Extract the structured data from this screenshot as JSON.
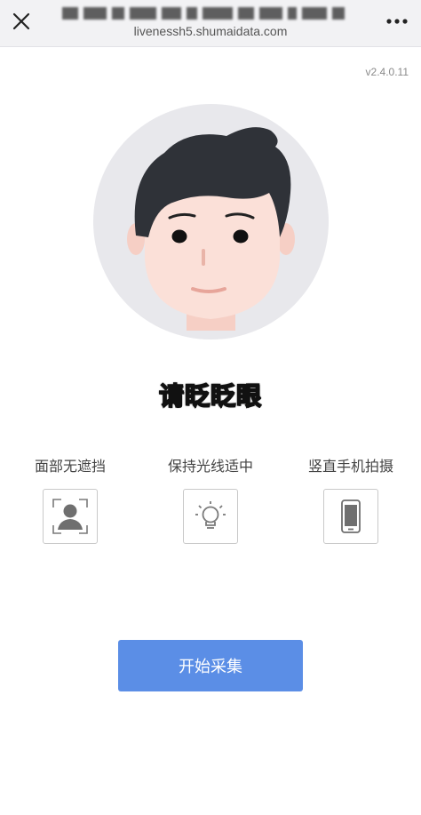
{
  "topbar": {
    "url": "livenessh5.shumaidata.com",
    "close_icon": "close-icon",
    "menu_icon": "more-icon"
  },
  "version": "v2.4.0.11",
  "prompt": "请眨眨眼",
  "tips": [
    {
      "label": "面部无遮挡",
      "icon": "portrait-frame-icon"
    },
    {
      "label": "保持光线适中",
      "icon": "lightbulb-icon"
    },
    {
      "label": "竖直手机拍摄",
      "icon": "phone-icon"
    }
  ],
  "start_button": "开始采集",
  "colors": {
    "accent": "#5b8ee6",
    "prompt_text": "#e8d21a",
    "avatar_bg": "#e8e8ec",
    "hair": "#2f3238",
    "skin": "#fbe0d8"
  }
}
